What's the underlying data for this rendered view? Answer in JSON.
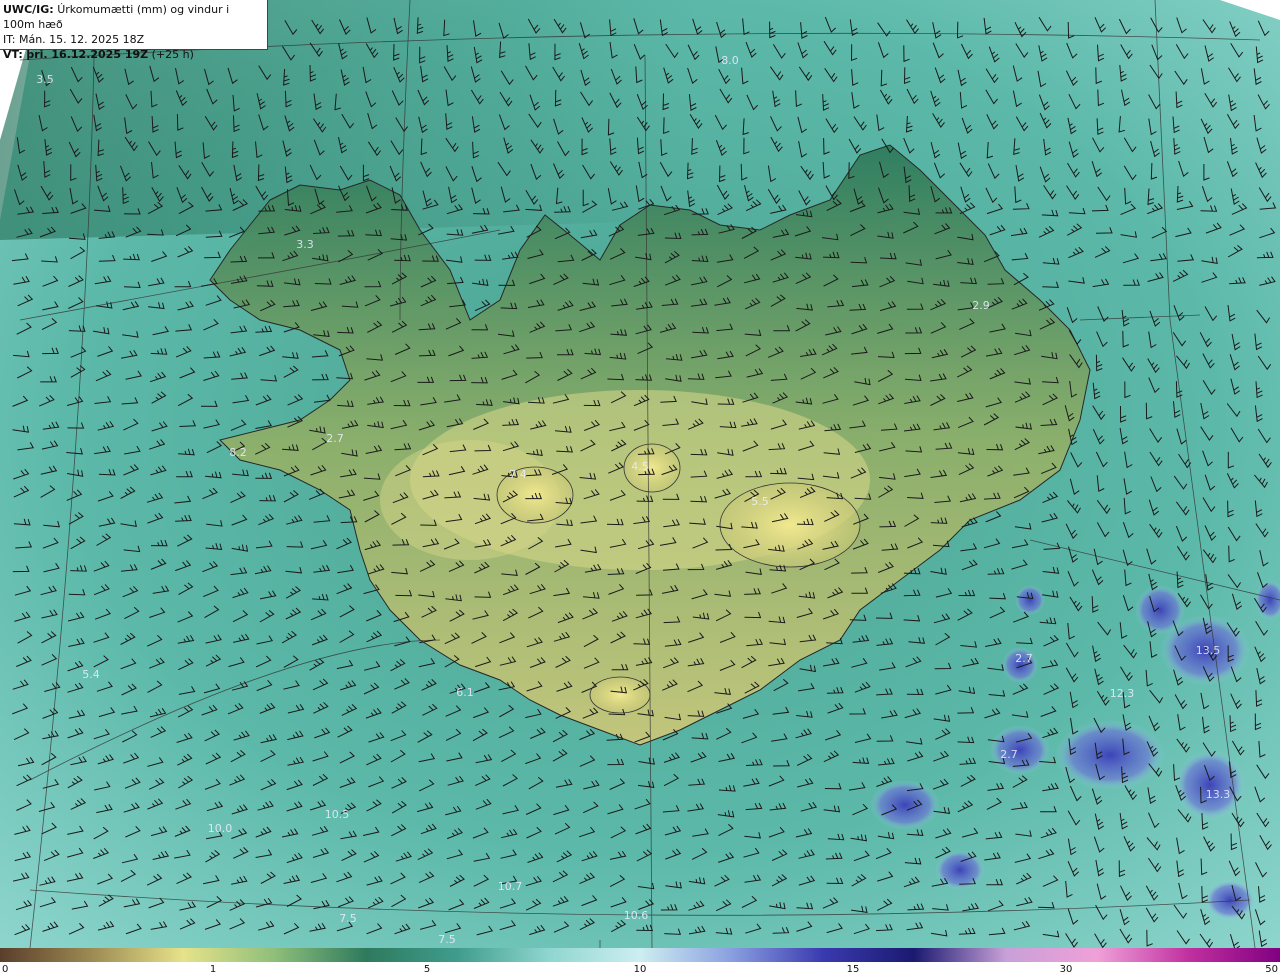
{
  "header": {
    "model_label": "UWC/IG:",
    "product": "Úrkomumætti (mm) og vindur i 100m hæð",
    "it_label": "IT:",
    "it_value": "Mán. 15. 12. 2025 18Z",
    "vt_label": "VT:",
    "vt_value": "þri. 16.12.2025 19Z",
    "lead": "(+25 h)"
  },
  "value_labels": [
    "3.5",
    "3.3",
    "2.7",
    "2.9",
    "5.4",
    "6.1",
    "2.7",
    "13.5",
    "2.7",
    "13.3",
    "10.0",
    "10.5",
    "10.7",
    "7.5",
    "7.5",
    "10.6",
    "8.0",
    "12.3",
    "8.2",
    "7.4",
    "4.5",
    "5.5"
  ],
  "colorbar": {
    "ticks": [
      "0",
      "1",
      "5",
      "10",
      "15",
      "30",
      "50"
    ],
    "colors": [
      "#5a3e2b",
      "#9c8a52",
      "#e6e28a",
      "#8fbf7a",
      "#2e7a5e",
      "#3f9c8c",
      "#8fd6d0",
      "#cdeef0",
      "#8aa0e0",
      "#3a3ab0",
      "#1a1a70",
      "#c8a0d8",
      "#f0a0d8",
      "#c030a0",
      "#800080"
    ]
  },
  "colors": {
    "ocean": "#5fb8a8",
    "land_low": "#2f7d60",
    "land_high": "#d8d98a",
    "heavy": "#5460c8"
  }
}
